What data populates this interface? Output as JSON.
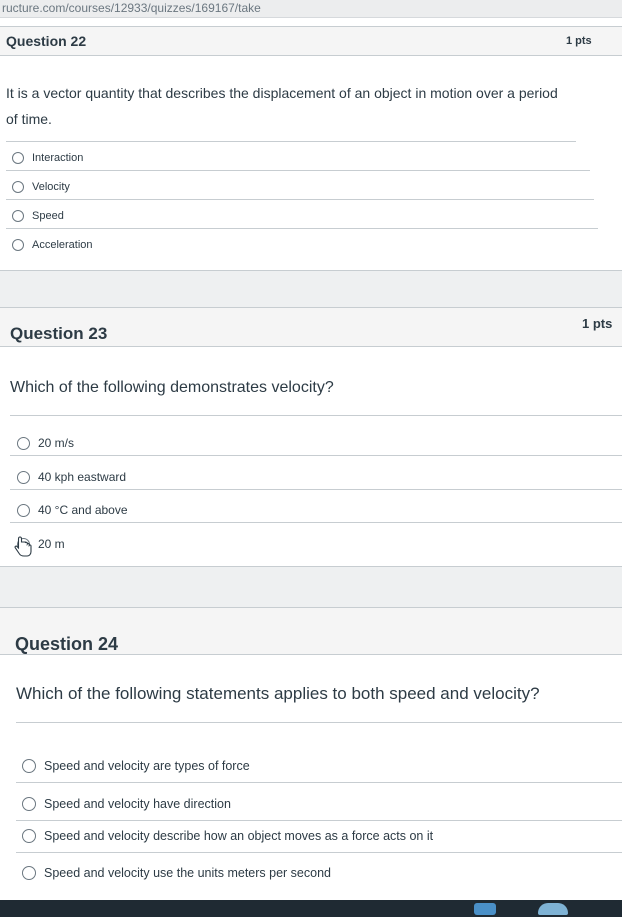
{
  "browser": {
    "url": "ructure.com/courses/12933/quizzes/169167/take"
  },
  "questions": [
    {
      "title": "Question 22",
      "points": "1 pts",
      "text": "It is a vector quantity that describes the displacement of an object in motion over a period of time.",
      "answers": [
        "Interaction",
        "Velocity",
        "Speed",
        "Acceleration"
      ]
    },
    {
      "title": "Question 23",
      "points": "1 pts",
      "text": "Which of the following demonstrates velocity?",
      "answers": [
        "20 m/s",
        "40 kph eastward",
        "40 °C and above",
        "20 m"
      ]
    },
    {
      "title": "Question 24",
      "text": "Which of the following statements applies to both speed and velocity?",
      "answers": [
        "Speed and velocity are types of force",
        "Speed and velocity have direction",
        "Speed and velocity describe how an object moves as a force acts on it",
        "Speed and velocity use the units meters per second"
      ]
    }
  ],
  "icons": {
    "radio": "radio-button-unselected-icon",
    "cursor": "mouse-pointer-icon"
  },
  "colors": {
    "text": "#2d3b45",
    "header_bg": "#f5f5f5",
    "border": "#c7cdd1"
  }
}
